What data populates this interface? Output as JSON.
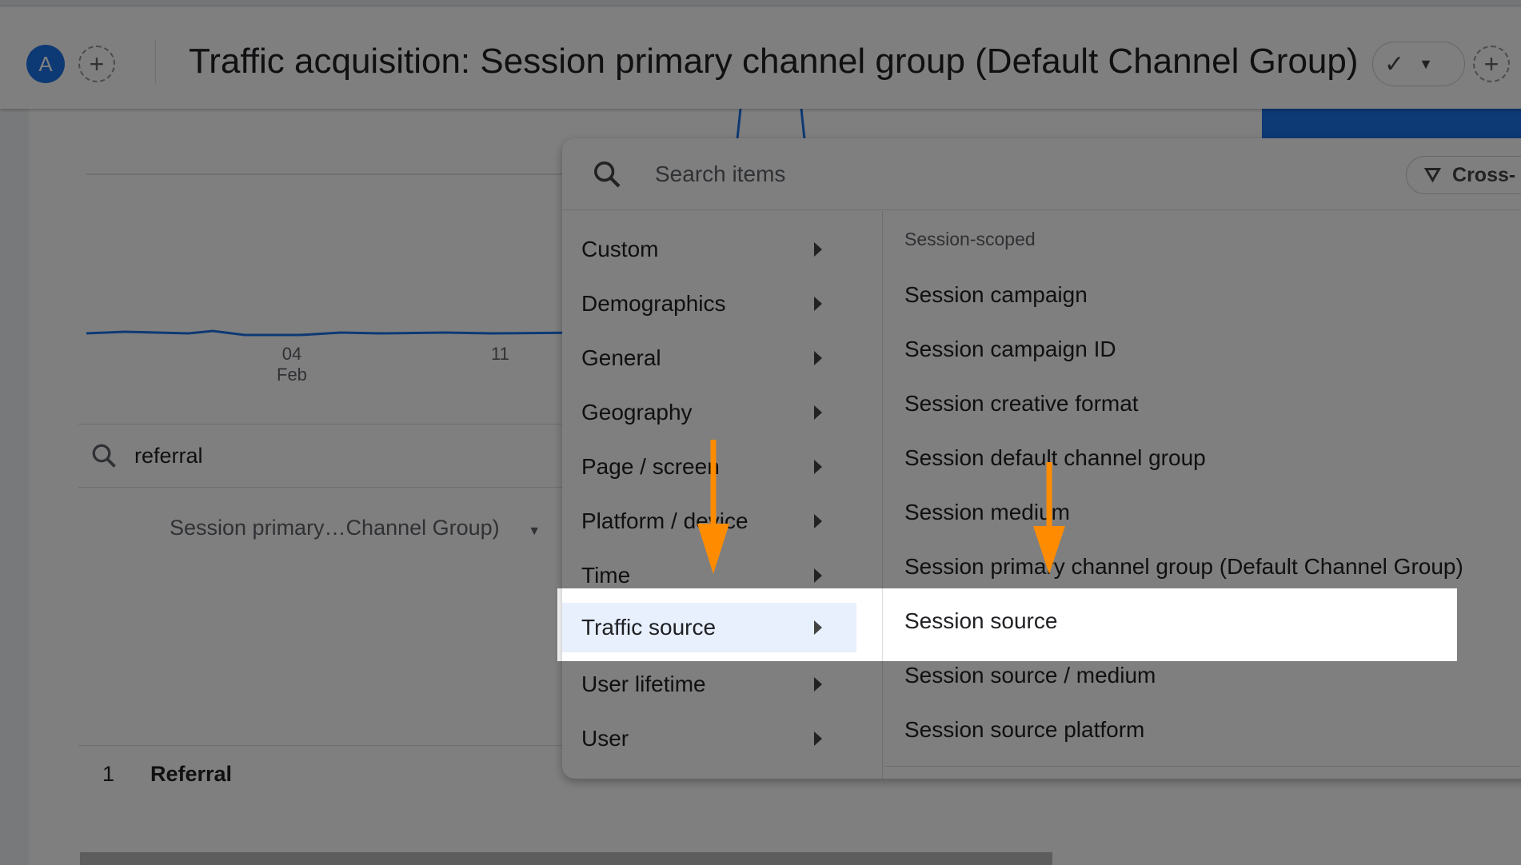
{
  "header": {
    "avatar": "A",
    "title": "Traffic acquisition: Session primary channel group (Default Channel Group)",
    "add_comparison_icon": "plus-icon",
    "check_icon": "check-circle-icon"
  },
  "chart": {
    "x_labels": [
      {
        "day": "04",
        "month": "Feb"
      },
      {
        "day": "11",
        "month": ""
      }
    ],
    "line_color": "#1a73e8"
  },
  "table": {
    "search_value": "referral",
    "dimension_dropdown": "Session primary…Channel Group)",
    "rows": [
      {
        "index": "1",
        "label": "Referral"
      }
    ]
  },
  "menu": {
    "search_placeholder": "Search items",
    "cross_button": "Cross-",
    "categories": [
      "Custom",
      "Demographics",
      "General",
      "Geography",
      "Page / screen",
      "Platform / device",
      "Time",
      "Traffic source",
      "User lifetime",
      "User"
    ],
    "selected_category": "Traffic source",
    "section_header": "Session-scoped",
    "items": [
      "Session campaign",
      "Session campaign ID",
      "Session creative format",
      "Session default channel group",
      "Session medium",
      "Session primary channel group (Default Channel Group)",
      "Session source",
      "Session source / medium",
      "Session source platform"
    ],
    "highlighted_item": "Session source"
  },
  "colors": {
    "accent": "#1a73e8",
    "arrow": "#ff8c00",
    "selected_bg": "#e8f0fe"
  }
}
